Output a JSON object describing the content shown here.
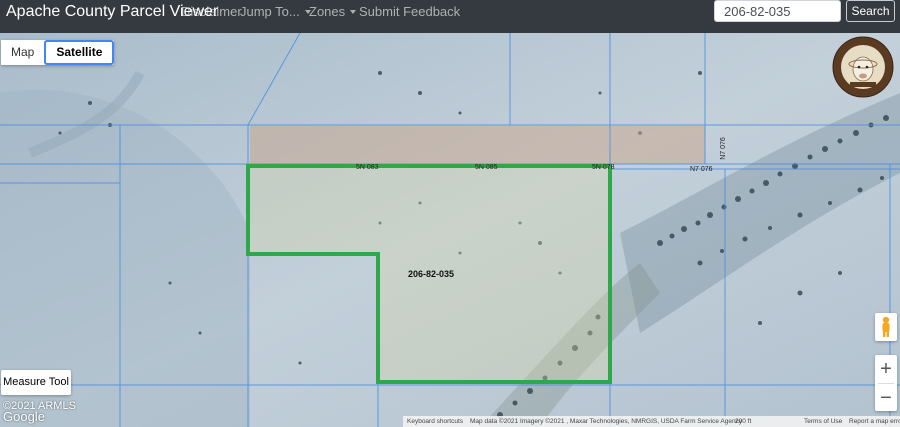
{
  "app": {
    "title": "Apache County Parcel Viewer"
  },
  "nav": {
    "disclaimer": "Disclaimer",
    "jump_to": "Jump To...",
    "zones": "Zones",
    "feedback": "Submit Feedback"
  },
  "search": {
    "value": "206-82-035",
    "button": "Search"
  },
  "map": {
    "type_map": "Map",
    "type_satellite": "Satellite",
    "selected_type": "Satellite",
    "parcel_label": "206-82-035",
    "measure_tool": "Measure Tool",
    "copyright": "©2021 ARMLS",
    "google": "Google",
    "zoom_in": "+",
    "zoom_out": "−",
    "seal_alt": "Apache County seal",
    "labels": {
      "left_parcel": "5N 083",
      "mid_parcel": "5N 085",
      "right_parcel": "5N 078",
      "east_parcel": "N7 076",
      "road": "N7 076"
    }
  },
  "attribution": {
    "shortcuts": "Keyboard shortcuts",
    "map_data": "Map data ©2021 Imagery ©2021 , Maxar Technologies, NMRGIS, USDA Farm Service Agency",
    "scale": "200 ft",
    "terms": "Terms of Use",
    "report": "Report a map error"
  },
  "colors": {
    "navbar": "#343a40",
    "parcel_outline": "#2ea84a",
    "parcel_lines": "#4a8fe0",
    "highlight_fill": "#c9a88f"
  }
}
